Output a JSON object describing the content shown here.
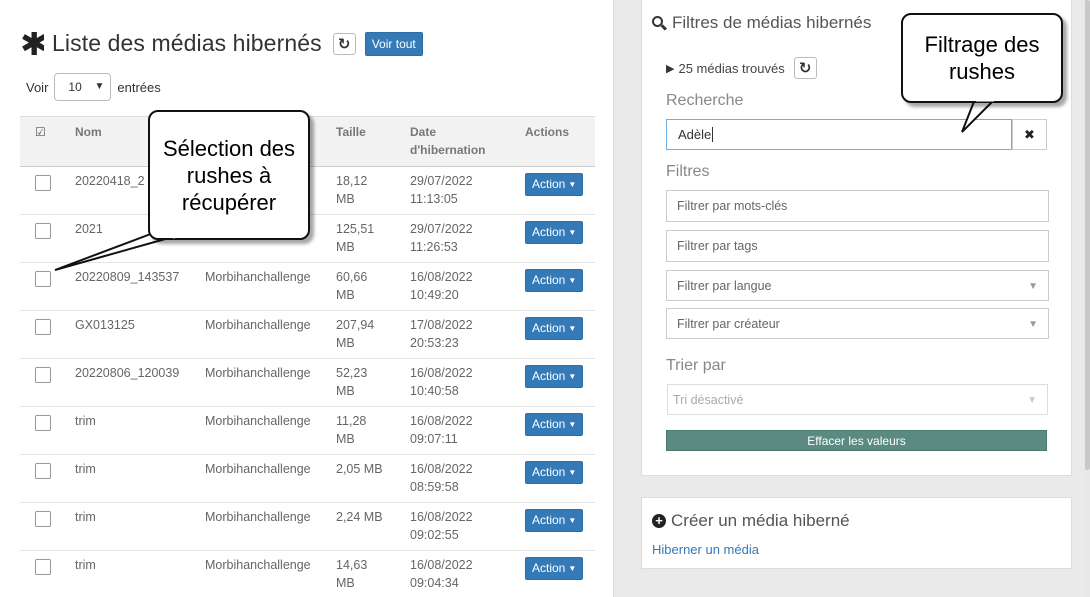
{
  "list": {
    "title": "Liste des médias hibernés",
    "title_icon": "asterisk-icon",
    "refresh_icon": "refresh-icon",
    "voir_tout": "Voir tout",
    "show_label": "Voir",
    "page_size": "10",
    "entries_label": "entrées",
    "columns": [
      "Nom",
      "Taille",
      "Date d'hibernation",
      "Actions"
    ],
    "rows": [
      {
        "name": "20220418_2",
        "category": "",
        "size": "18,12 MB",
        "date": "29/07/2022 11:13:05",
        "action": "Action"
      },
      {
        "name": "2021",
        "category": "",
        "size": "125,51 MB",
        "date": "29/07/2022 11:26:53",
        "action": "Action"
      },
      {
        "name": "20220809_143537",
        "category": "Morbihanchallenge",
        "size": "60,66 MB",
        "date": "16/08/2022 10:49:20",
        "action": "Action"
      },
      {
        "name": "GX013125",
        "category": "Morbihanchallenge",
        "size": "207,94 MB",
        "date": "17/08/2022 20:53:23",
        "action": "Action"
      },
      {
        "name": "20220806_120039",
        "category": "Morbihanchallenge",
        "size": "52,23 MB",
        "date": "16/08/2022 10:40:58",
        "action": "Action"
      },
      {
        "name": "trim",
        "category": "Morbihanchallenge",
        "size": "11,28 MB",
        "date": "16/08/2022 09:07:11",
        "action": "Action"
      },
      {
        "name": "trim",
        "category": "Morbihanchallenge",
        "size": "2,05 MB",
        "date": "16/08/2022 08:59:58",
        "action": "Action"
      },
      {
        "name": "trim",
        "category": "Morbihanchallenge",
        "size": "2,24 MB",
        "date": "16/08/2022 09:02:55",
        "action": "Action"
      },
      {
        "name": "trim",
        "category": "Morbihanchallenge",
        "size": "14,63 MB",
        "date": "16/08/2022 09:04:34",
        "action": "Action"
      }
    ]
  },
  "filters": {
    "title": "Filtres de médias hibernés",
    "found": "25 médias trouvés",
    "search_label": "Recherche",
    "search_value": "Adèle",
    "filters_label": "Filtres",
    "keywords_placeholder": "Filtrer par mots-clés",
    "tags_placeholder": "Filtrer par tags",
    "language_placeholder": "Filtrer par langue",
    "creator_placeholder": "Filtrer par créateur",
    "sort_label": "Trier par",
    "sort_value": "Tri désactivé",
    "clear_values": "Effacer les valeurs",
    "clear_color": "#5a8a80"
  },
  "create": {
    "title": "Créer un média hiberné",
    "link": "Hiberner un média"
  },
  "callouts": {
    "selection": "Sélection des rushes à récupérer",
    "filtering": "Filtrage des rushes"
  },
  "colors": {
    "primary": "#337ab7",
    "focus_border": "#66afe9"
  }
}
